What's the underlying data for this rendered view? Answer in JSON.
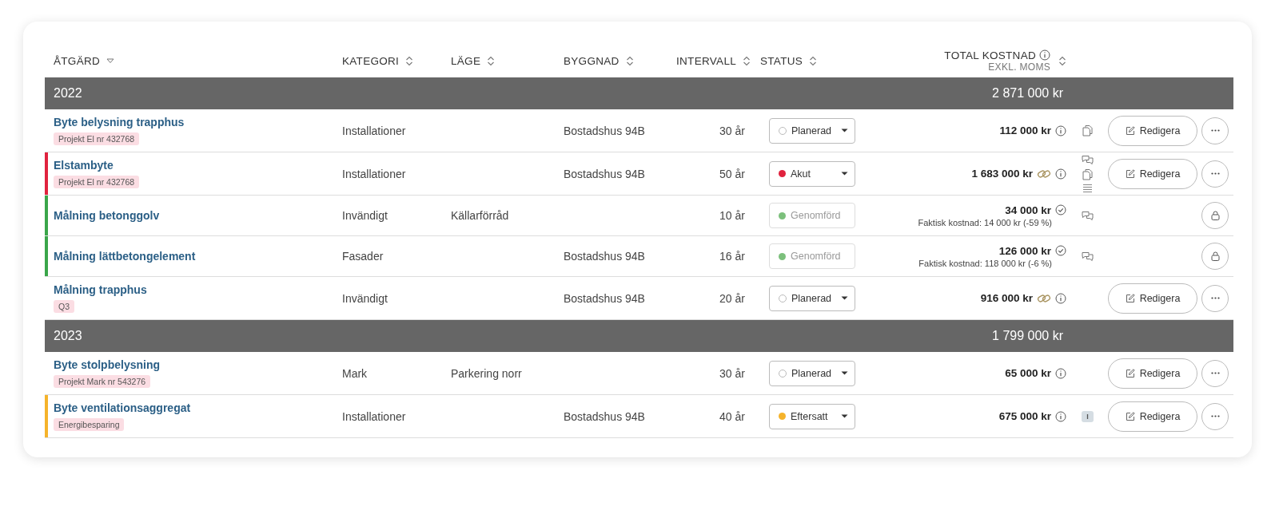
{
  "columns": [
    {
      "label": "ÅTGÄRD",
      "sorted": true
    },
    {
      "label": "KATEGORI",
      "sorted": false
    },
    {
      "label": "LÄGE",
      "sorted": false
    },
    {
      "label": "BYGGNAD",
      "sorted": false
    },
    {
      "label": "INTERVALL",
      "sorted": false
    },
    {
      "label": "STATUS",
      "sorted": false
    },
    {
      "label": "TOTAL KOSTNAD",
      "sublabel": "EXKL. MOMS",
      "info": true,
      "sorted": false
    }
  ],
  "groups": [
    {
      "year": "2022",
      "total": "2 871 000 kr",
      "rows": [
        {
          "title": "Byte belysning trapphus",
          "tag": "Projekt El nr 432768",
          "category": "Installationer",
          "building": "Bostadshus 94B",
          "interval": "30 år",
          "status": {
            "label": "Planerad",
            "disabled": false
          },
          "cost": "112 000 kr",
          "linked": false,
          "done": false,
          "side_icons": [
            {
              "kind": "copy"
            }
          ],
          "actions": {
            "kind": "edit",
            "label": "Redigera"
          }
        },
        {
          "title": "Elstambyte",
          "tag": "Projekt El nr 432768",
          "color": "#e0223e",
          "category": "Installationer",
          "building": "Bostadshus 94B",
          "interval": "50 år",
          "status": {
            "label": "Akut",
            "color": "#e0223e",
            "disabled": false
          },
          "cost": "1 683 000 kr",
          "linked": true,
          "done": false,
          "side_icons": [
            {
              "kind": "comments"
            },
            {
              "kind": "copy"
            },
            {
              "kind": "notes"
            }
          ],
          "actions": {
            "kind": "edit",
            "label": "Redigera"
          }
        },
        {
          "title": "Målning betonggolv",
          "color": "#3aa64a",
          "category": "Invändigt",
          "location": "Källarförråd",
          "interval": "10 år",
          "status": {
            "label": "Genomförd",
            "color": "#7cc07c",
            "disabled": true
          },
          "cost": "34 000 kr",
          "linked": false,
          "done": true,
          "actual_cost": "Faktisk kostnad: 14 000 kr (-59 %)",
          "side_icons": [
            {
              "kind": "comments"
            }
          ],
          "actions": {
            "kind": "locked"
          }
        },
        {
          "title": "Målning lättbetongelement",
          "color": "#3aa64a",
          "category": "Fasader",
          "building": "Bostadshus 94B",
          "interval": "16 år",
          "status": {
            "label": "Genomförd",
            "color": "#7cc07c",
            "disabled": true
          },
          "cost": "126 000 kr",
          "linked": false,
          "done": true,
          "actual_cost": "Faktisk kostnad: 118 000 kr (-6 %)",
          "side_icons": [
            {
              "kind": "comments"
            }
          ],
          "actions": {
            "kind": "locked"
          }
        },
        {
          "title": "Målning trapphus",
          "tag": "Q3",
          "category": "Invändigt",
          "building": "Bostadshus 94B",
          "interval": "20 år",
          "status": {
            "label": "Planerad",
            "disabled": false
          },
          "cost": "916 000 kr",
          "linked": true,
          "done": false,
          "actions": {
            "kind": "edit",
            "label": "Redigera"
          }
        }
      ]
    },
    {
      "year": "2023",
      "total": "1 799 000 kr",
      "rows": [
        {
          "title": "Byte stolpbelysning",
          "tag": "Projekt Mark nr 543276",
          "category": "Mark",
          "location": "Parkering norr",
          "interval": "30 år",
          "status": {
            "label": "Planerad",
            "disabled": false
          },
          "cost": "65 000 kr",
          "linked": false,
          "done": false,
          "actions": {
            "kind": "edit",
            "label": "Redigera"
          }
        },
        {
          "title": "Byte ventilationsaggregat",
          "tag": "Energibesparing",
          "color": "#f5b32b",
          "category": "Installationer",
          "building": "Bostadshus 94B",
          "interval": "40 år",
          "status": {
            "label": "Eftersatt",
            "color": "#f5b32b",
            "disabled": false
          },
          "cost": "675 000 kr",
          "linked": false,
          "done": false,
          "side_icons": [
            {
              "kind": "badge",
              "text": "I"
            }
          ],
          "actions": {
            "kind": "edit",
            "label": "Redigera"
          }
        }
      ]
    }
  ]
}
